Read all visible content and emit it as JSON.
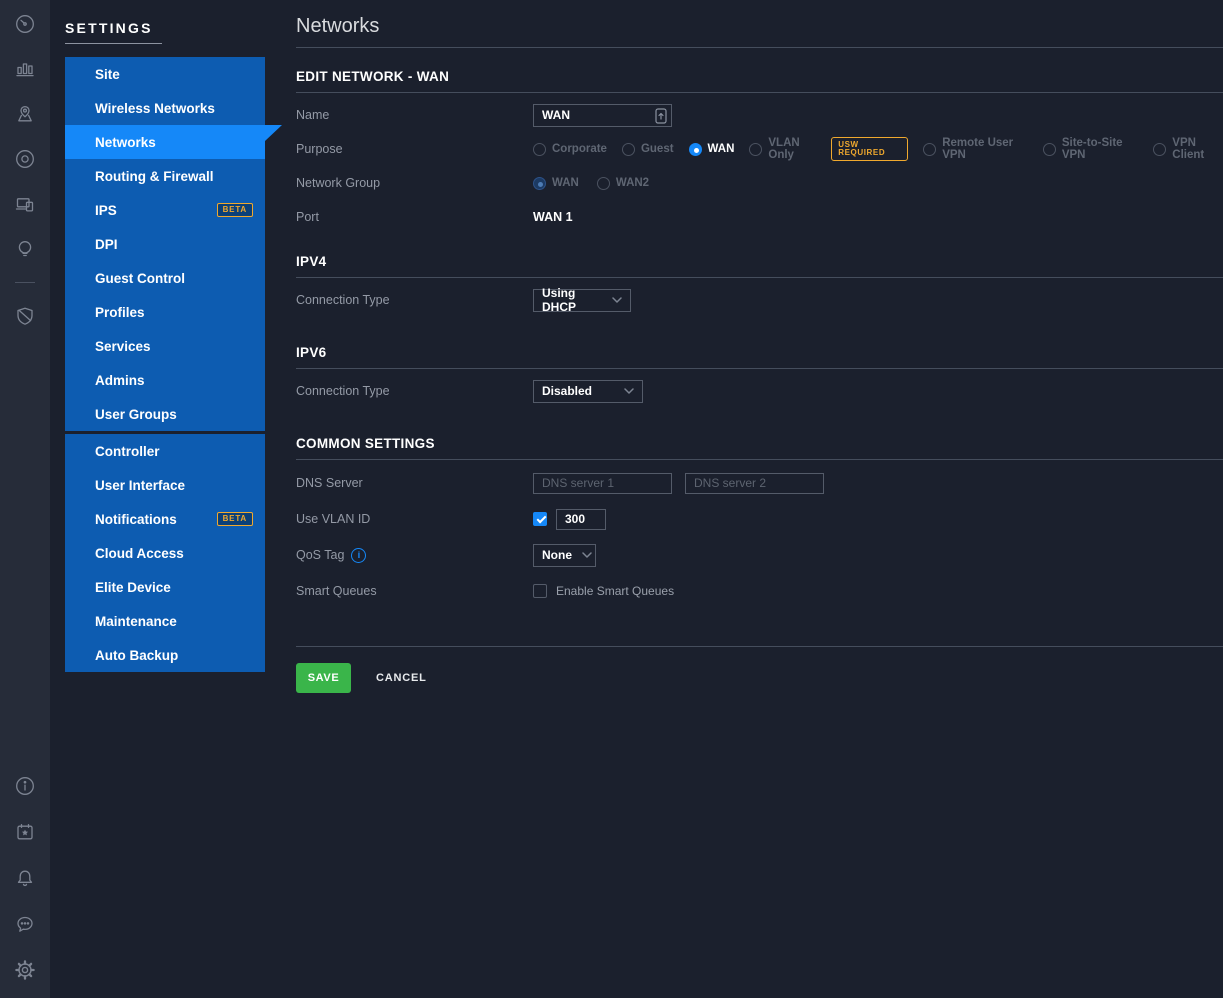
{
  "colors": {
    "accent_blue": "#1588f8",
    "sidebar_blue": "#0d5cb1",
    "save_green": "#3ab54a",
    "badge_amber": "#f0a92e",
    "rail_bg": "#262c39",
    "page_bg": "#1b202d"
  },
  "rail": {
    "top_icons": [
      "dashboard",
      "statistics",
      "map",
      "devices",
      "clients",
      "insights",
      "threat-management"
    ],
    "bottom_icons": [
      "info",
      "whats-new",
      "notifications",
      "chat",
      "settings"
    ]
  },
  "sidebar": {
    "title": "SETTINGS",
    "beta_label": "BETA",
    "groups": [
      {
        "items": [
          {
            "label": "Site"
          },
          {
            "label": "Wireless Networks"
          },
          {
            "label": "Networks",
            "selected": true
          },
          {
            "label": "Routing & Firewall"
          },
          {
            "label": "IPS",
            "beta": true
          },
          {
            "label": "DPI"
          },
          {
            "label": "Guest Control"
          },
          {
            "label": "Profiles"
          },
          {
            "label": "Services"
          },
          {
            "label": "Admins"
          },
          {
            "label": "User Groups"
          }
        ]
      },
      {
        "items": [
          {
            "label": "Controller"
          },
          {
            "label": "User Interface"
          },
          {
            "label": "Notifications",
            "beta": true
          },
          {
            "label": "Cloud Access"
          },
          {
            "label": "Elite Device"
          },
          {
            "label": "Maintenance"
          },
          {
            "label": "Auto Backup"
          }
        ]
      }
    ]
  },
  "main": {
    "page_title": "Networks",
    "edit_section_title": "EDIT NETWORK - WAN",
    "name": {
      "label": "Name",
      "value": "WAN"
    },
    "purpose": {
      "label": "Purpose",
      "options": [
        "Corporate",
        "Guest",
        "WAN",
        "VLAN Only",
        "Remote User VPN",
        "Site-to-Site VPN",
        "VPN Client"
      ],
      "selected": "WAN",
      "usw_badge": "USW REQUIRED"
    },
    "network_group": {
      "label": "Network Group",
      "options": [
        "WAN",
        "WAN2"
      ],
      "selected": "WAN"
    },
    "port": {
      "label": "Port",
      "value": "WAN 1"
    },
    "ipv4": {
      "title": "IPV4",
      "connection_type_label": "Connection Type",
      "connection_type_value": "Using DHCP"
    },
    "ipv6": {
      "title": "IPV6",
      "connection_type_label": "Connection Type",
      "connection_type_value": "Disabled"
    },
    "common": {
      "title": "COMMON SETTINGS",
      "dns": {
        "label": "DNS Server",
        "placeholder1": "DNS server 1",
        "placeholder2": "DNS server 2"
      },
      "vlan": {
        "label": "Use VLAN ID",
        "checked": true,
        "value": "300"
      },
      "qos": {
        "label": "QoS Tag",
        "value": "None"
      },
      "smart_queues": {
        "label": "Smart Queues",
        "checkbox_label": "Enable Smart Queues",
        "checked": false
      }
    },
    "actions": {
      "save": "SAVE",
      "cancel": "CANCEL"
    }
  }
}
